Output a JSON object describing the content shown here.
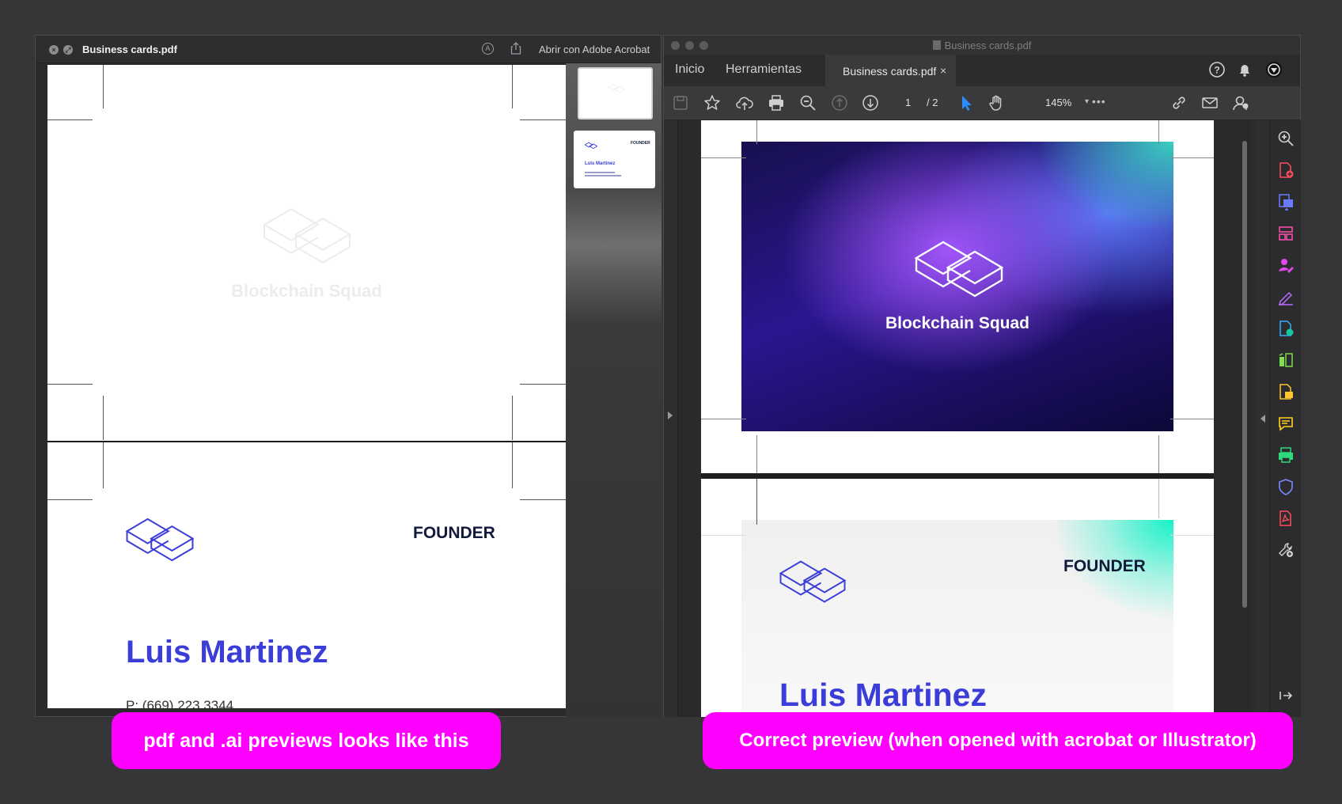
{
  "quicklook": {
    "filename": "Business cards.pdf",
    "open_with": "Abrir con Adobe Acrobat",
    "page_front": {
      "brand": "Blockchain Squad"
    },
    "page_back": {
      "role": "FOUNDER",
      "name": "Luis Martinez",
      "phone_partial": "P: (669) 223 3344"
    },
    "thumb2": {
      "role": "FOUNDER",
      "name": "Luis Martinez"
    }
  },
  "acrobat": {
    "title": "Business cards.pdf",
    "tabs": {
      "home": "Inicio",
      "tools": "Herramientas",
      "document": "Business cards.pdf",
      "close": "×"
    },
    "toolbar": {
      "page_current": "1",
      "page_total": "/ 2",
      "zoom": "145%",
      "more": "•••"
    },
    "card_front": {
      "brand": "Blockchain Squad"
    },
    "card_back": {
      "role": "FOUNDER",
      "name": "Luis Martinez"
    }
  },
  "captions": {
    "left": "pdf and .ai previews looks like this",
    "right": "Correct preview (when opened with acrobat  or Illustrator)"
  },
  "colors": {
    "accent_caption": "#ff00ff",
    "brand_blue": "#3b3dd9",
    "acrobat_select": "#2d8cff"
  },
  "icons": [
    "close-icon",
    "fullscreen-icon",
    "markup-icon",
    "share-icon",
    "save-icon",
    "star-icon",
    "cloud-upload-icon",
    "print-icon",
    "zoom-out-icon",
    "page-up-icon",
    "page-down-icon",
    "pointer-icon",
    "hand-icon",
    "link-icon",
    "mail-icon",
    "account-icon",
    "help-icon",
    "bell-icon",
    "profile-icon",
    "zoom-in-icon"
  ]
}
